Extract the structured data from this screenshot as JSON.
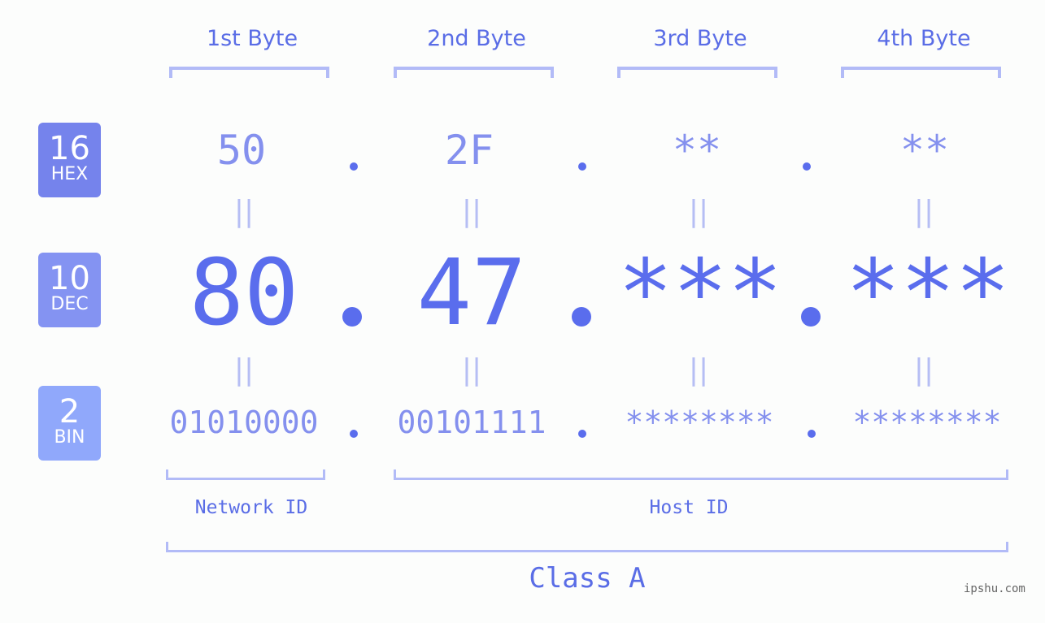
{
  "byte_headers": [
    "1st Byte",
    "2nd Byte",
    "3rd Byte",
    "4th Byte"
  ],
  "bases": [
    {
      "number": "16",
      "label": "HEX",
      "color": "#7583ec"
    },
    {
      "number": "10",
      "label": "DEC",
      "color": "#8493f2"
    },
    {
      "number": "2",
      "label": "BIN",
      "color": "#90a8fb"
    }
  ],
  "hex": [
    "50",
    "2F",
    "**",
    "**"
  ],
  "dec": [
    "80",
    "47",
    "***",
    "***"
  ],
  "bin": [
    "01010000",
    "00101111",
    "********",
    "********"
  ],
  "equals_symbol": "||",
  "separator": ".",
  "network_id_label": "Network ID",
  "host_id_label": "Host ID",
  "class_label": "Class A",
  "watermark": "ipshu.com",
  "colors": {
    "accent": "#5a6ded",
    "light_text": "#8490ee",
    "bracket": "#b2bbf7"
  }
}
